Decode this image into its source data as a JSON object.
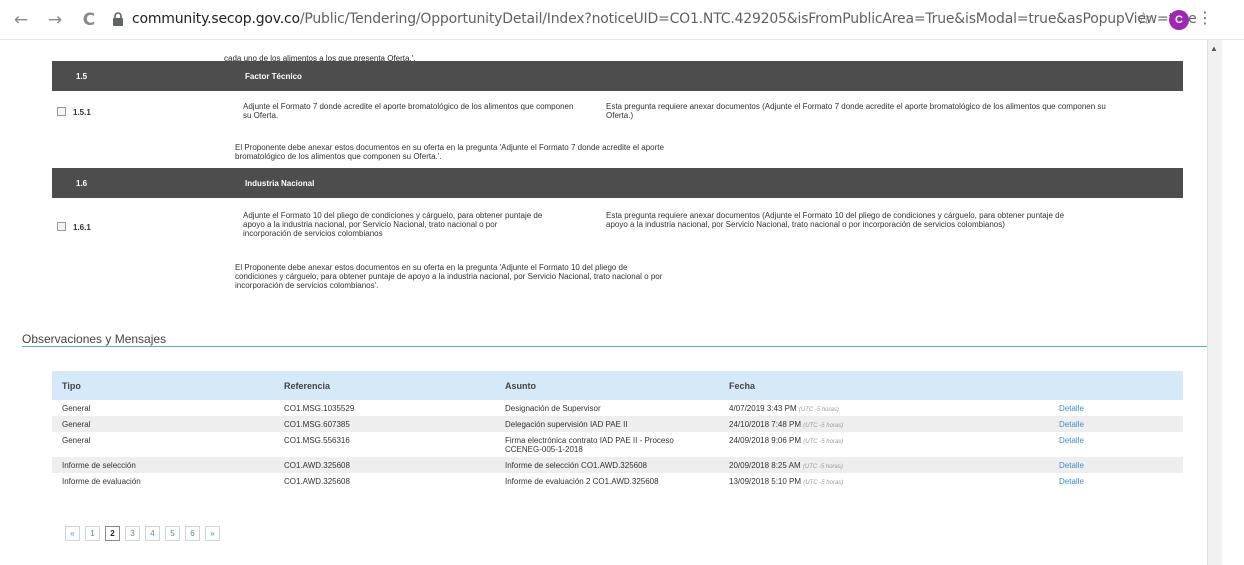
{
  "browser": {
    "url_host": "community.secop.gov.co",
    "url_path": "/Public/Tendering/OpportunityDetail/Index?noticeUID=CO1.NTC.429205&isFromPublicArea=True&isModal=true&asPopupView=true",
    "avatar_letter": "C",
    "back_glyph": "←",
    "forward_glyph": "→",
    "reload_glyph": "C",
    "star_glyph": "☆",
    "menu_glyph": "⋮"
  },
  "prev_text": "cada uno de los alimentos a los que presenta Oferta.'.",
  "sections": [
    {
      "num": "1.5",
      "title": "Factor Técnico",
      "question": {
        "num": "1.5.1",
        "text": "Adjunte el Formato 7 donde acredite el aporte bromatológico de los alimentos que componen su Oferta.",
        "requirement": "Esta pregunta requiere anexar documentos (Adjunte el Formato 7 donde acredite el aporte bromatológico de los alimentos que componen su Oferta.)",
        "note": "El Proponente debe anexar estos documentos en su oferta en la pregunta 'Adjunte el Formato 7 donde acredite el aporte bromatológico de los alimentos que componen su Oferta.'."
      }
    },
    {
      "num": "1.6",
      "title": "Industria Nacional",
      "question": {
        "num": "1.6.1",
        "text": "Adjunte el Formato 10 del pliego de condiciones y cárguelo, para obtener puntaje de apoyo a la industria nacional, por Servicio Nacional, trato nacional o por incorporación de servicios colombianos",
        "requirement": "Esta pregunta requiere anexar documentos (Adjunte el Formato 10 del pliego de condiciones y cárguelo, para obtener puntaje de apoyo a la industria nacional, por Servicio Nacional, trato nacional o por incorporación de servicios colombianos)",
        "note": "El Proponente debe anexar estos documentos en su oferta en la pregunta 'Adjunte el Formato 10 del pliego de condiciones y cárguelo, para obtener puntaje de apoyo a la industria nacional, por Servicio Nacional, trato nacional o por incorporación de servicios colombianos'."
      }
    }
  ],
  "observations": {
    "title": "Observaciones y Mensajes",
    "headers": [
      "Tipo",
      "Referencia",
      "Asunto",
      "Fecha"
    ],
    "timezone_note": "(UTC -5 horas)",
    "detail_label": "Detalle",
    "rows": [
      {
        "tipo": "General",
        "ref": "CO1.MSG.1035529",
        "asunto": "Designación de Supervisor",
        "fecha": "4/07/2019 3:43 PM"
      },
      {
        "tipo": "General",
        "ref": "CO1.MSG.607385",
        "asunto": "Delegación supervisión IAD PAE II",
        "fecha": "24/10/2018 7:48 PM"
      },
      {
        "tipo": "General",
        "ref": "CO1.MSG.556316",
        "asunto": "Firma electrónica contrato IAD PAE II - Proceso CCENEG-005-1-2018",
        "fecha": "24/09/2018 9:06 PM"
      },
      {
        "tipo": "Informe de selección",
        "ref": "CO1.AWD.325608",
        "asunto": "Informe de selección CO1.AWD.325608",
        "fecha": "20/09/2018 8:25 AM"
      },
      {
        "tipo": "Informe de evaluación",
        "ref": "CO1.AWD.325608",
        "asunto": "Informe de evaluación 2 CO1.AWD.325608",
        "fecha": "13/09/2018 5:10 PM"
      }
    ]
  },
  "pagination": {
    "first": "«",
    "pages": [
      "1",
      "2",
      "3",
      "4",
      "5",
      "6"
    ],
    "current": "2",
    "last": "»"
  }
}
